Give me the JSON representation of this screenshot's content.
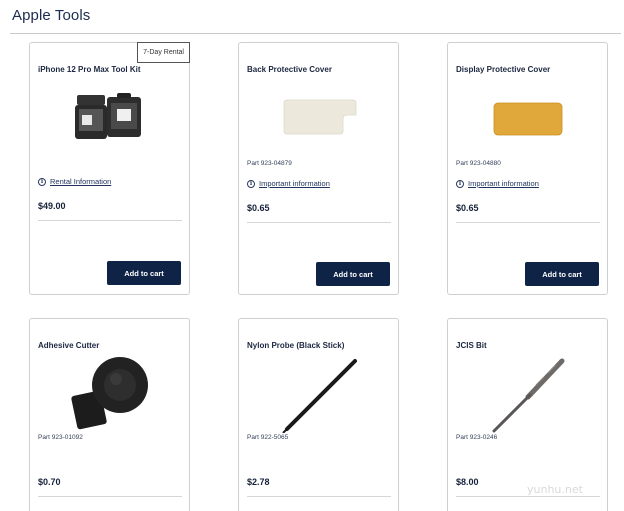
{
  "page": {
    "title": "Apple Tools"
  },
  "products": [
    {
      "name": "iPhone 12 Pro Max Tool Kit",
      "badge": "7-Day Rental",
      "info_label": "Rental Information",
      "price": "$49.00",
      "cart_label": "Add to cart",
      "image": "tool-kit-cases-image"
    },
    {
      "name": "Back Protective Cover",
      "part": "Part 923-04879",
      "info_label": "Important information",
      "price": "$0.65",
      "cart_label": "Add to cart",
      "image": "back-cover-image",
      "image_color": "#ece8dc"
    },
    {
      "name": "Display Protective Cover",
      "part": "Part 923-04880",
      "info_label": "Important information",
      "price": "$0.65",
      "cart_label": "Add to cart",
      "image": "display-cover-image",
      "image_color": "#e0a83a"
    },
    {
      "name": "Adhesive Cutter",
      "part": "Part 923-01092",
      "price": "$0.70",
      "image": "adhesive-cutter-image"
    },
    {
      "name": "Nylon Probe (Black Stick)",
      "part": "Part 922-5065",
      "price": "$2.78",
      "image": "nylon-probe-image"
    },
    {
      "name": "JCIS Bit",
      "part": "Part 923-0246",
      "price": "$8.00",
      "image": "jcis-bit-image"
    }
  ],
  "watermark": "yunhu.net"
}
